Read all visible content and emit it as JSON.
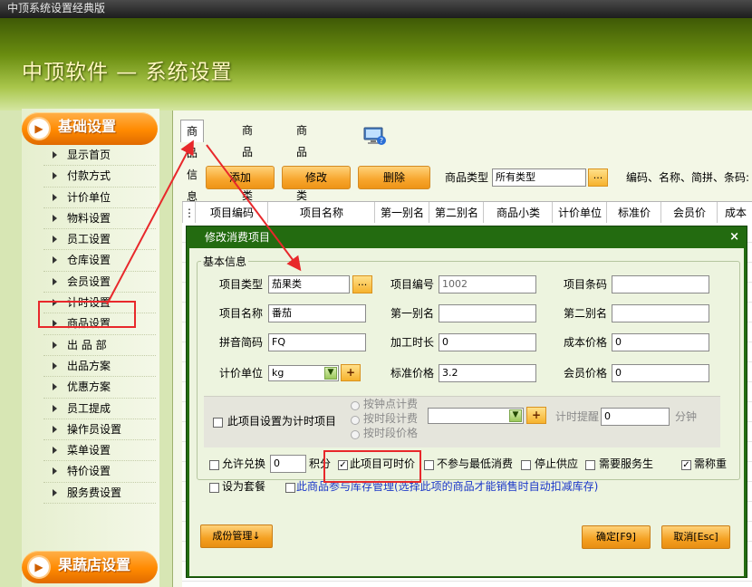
{
  "window": {
    "title": "中顶系统设置经典版"
  },
  "banner": {
    "title": "中顶软件 — 系统设置"
  },
  "sidebar": {
    "section_title": "基础设置",
    "items": [
      "显示首页",
      "付款方式",
      "计价单位",
      "物料设置",
      "员工设置",
      "仓库设置",
      "会员设置",
      "计时设置",
      "商品设置",
      "出 品 部",
      "出品方案",
      "优惠方案",
      "员工提成",
      "操作员设置",
      "菜单设置",
      "特价设置",
      "服务费设置"
    ],
    "bottom_section_title": "果蔬店设置"
  },
  "tabs": [
    "商品信息",
    "商品大类",
    "商品小类"
  ],
  "toolbar": {
    "add": "添加",
    "edit": "修改",
    "delete": "删除",
    "type_label": "商品类型",
    "type_value": "所有类型",
    "type_btn": "...",
    "search_label": "编码、名称、简拼、条码:"
  },
  "grid": {
    "columns": [
      "项目编码",
      "项目名称",
      "第一别名",
      "第二别名",
      "商品小类",
      "计价单位",
      "标准价",
      "会员价",
      "成本"
    ]
  },
  "dialog": {
    "title": "修改消费项目",
    "close": "×",
    "group_title": "基本信息",
    "item_type_label": "项目类型",
    "item_type_value": "茄果类",
    "item_type_btn": "...",
    "item_code_label": "项目编号",
    "item_code_value": "1002",
    "barcode_label": "项目条码",
    "barcode_value": "",
    "name_label": "项目名称",
    "name_value": "番茄",
    "alias1_label": "第一别名",
    "alias1_value": "",
    "alias2_label": "第二别名",
    "alias2_value": "",
    "pinyin_label": "拼音简码",
    "pinyin_value": "FQ",
    "duration_label": "加工时长",
    "duration_value": "0",
    "cost_label": "成本价格",
    "cost_value": "0",
    "unit_label": "计价单位",
    "unit_value": "kg",
    "unit_plus": "+",
    "std_price_label": "标准价格",
    "std_price_value": "3.2",
    "member_price_label": "会员价格",
    "member_price_value": "0",
    "timed_label": "此项目设置为计时项目",
    "radio_options": [
      "按钟点计费",
      "按时段计费",
      "按时段价格"
    ],
    "timed_plus": "+",
    "remind_label": "计时提醒",
    "remind_value": "0",
    "remind_unit": "分钟",
    "allow_redeem_label": "允许兑换",
    "redeem_points_value": "0",
    "points_label": "积分",
    "timed_price_label": "此项目可时价",
    "no_min_label": "不参与最低消费",
    "stop_supply_label": "停止供应",
    "need_server_label": "需要服务生",
    "need_weigh_label": "需称重",
    "set_combo_label": "设为套餐",
    "inventory_label": "此商品参与库存管理(选择此项的商品才能销售时自动扣减库存)",
    "ingredient_btn": "成份管理↓",
    "ok_btn": "确定[F9]",
    "cancel_btn": "取消[Esc]"
  },
  "checkbox_states": {
    "timed_price": true,
    "need_weigh": true
  },
  "colors": {
    "accent_orange": "#f7a52c",
    "dialog_green": "#236b10",
    "highlight_red": "#e8282b",
    "link_blue": "#1a36c8"
  }
}
